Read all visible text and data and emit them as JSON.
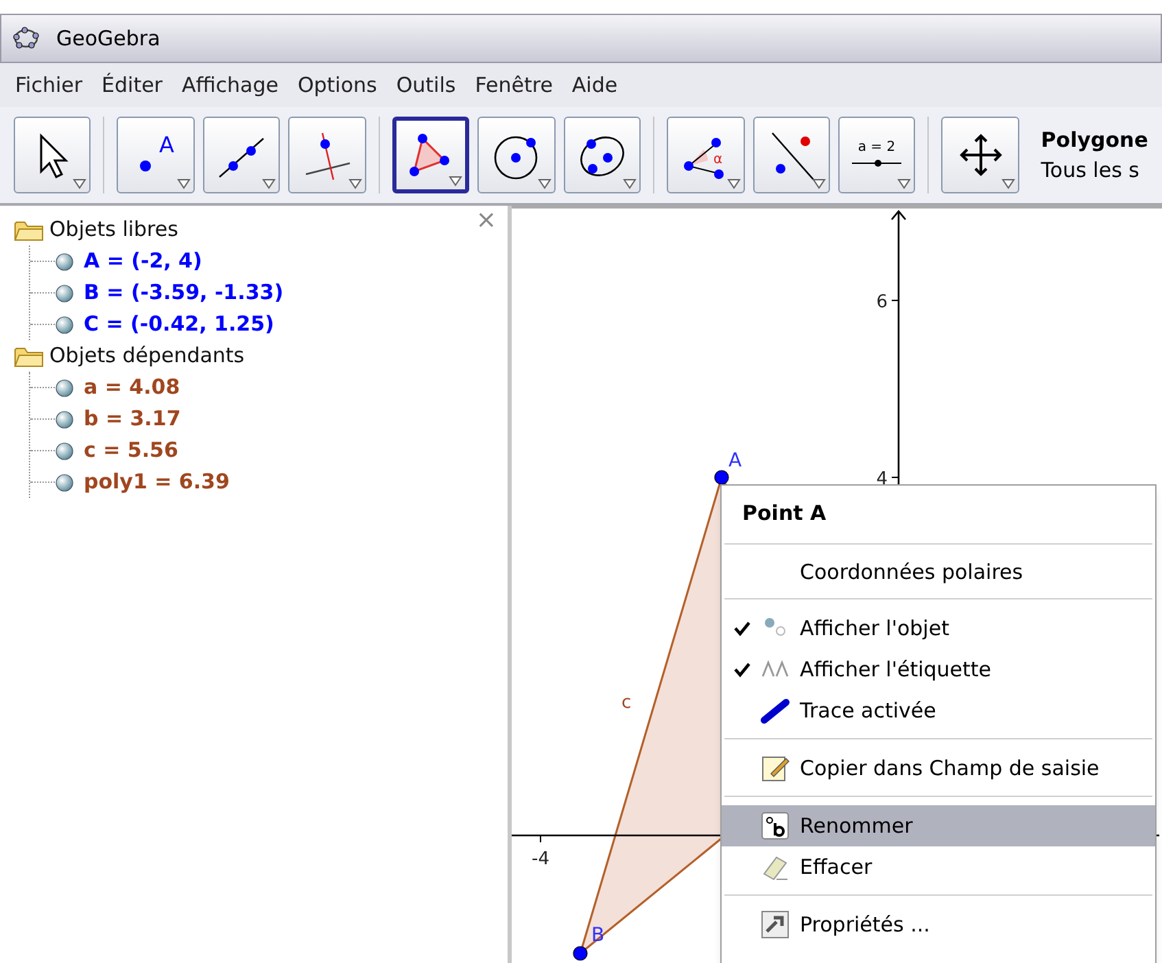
{
  "window": {
    "title": "GeoGebra"
  },
  "menu": [
    "Fichier",
    "Éditer",
    "Affichage",
    "Options",
    "Outils",
    "Fenêtre",
    "Aide"
  ],
  "toolbar": {
    "groups": [
      [
        {
          "kind": "pointer",
          "selected": false
        }
      ],
      [
        {
          "kind": "point",
          "label": "A",
          "selected": false
        },
        {
          "kind": "line",
          "selected": false
        },
        {
          "kind": "perpendicular",
          "selected": false
        }
      ],
      [
        {
          "kind": "polygon",
          "selected": true
        },
        {
          "kind": "circle",
          "selected": false
        },
        {
          "kind": "conic",
          "selected": false
        }
      ],
      [
        {
          "kind": "angle",
          "label": "α",
          "selected": false
        },
        {
          "kind": "reflect",
          "selected": false
        },
        {
          "kind": "slider",
          "label": "a = 2",
          "selected": false
        }
      ],
      [
        {
          "kind": "move",
          "selected": false
        }
      ]
    ],
    "tool_name": "Polygone",
    "tool_help": "Tous les s"
  },
  "algebra": {
    "close": "×",
    "folders": [
      {
        "label": "Objets libres",
        "items": [
          {
            "text": "A = (-2, 4)",
            "color": "#0000ff"
          },
          {
            "text": "B = (-3.59, -1.33)",
            "color": "#0000ff"
          },
          {
            "text": "C = (-0.42, 1.25)",
            "color": "#0000ff"
          }
        ]
      },
      {
        "label": "Objets dépendants",
        "items": [
          {
            "text": "a = 4.08",
            "color": "#a0461e"
          },
          {
            "text": "b = 3.17",
            "color": "#a0461e"
          },
          {
            "text": "c = 5.56",
            "color": "#a0461e"
          },
          {
            "text": "poly1 = 6.39",
            "color": "#a0461e"
          }
        ]
      }
    ]
  },
  "graphics": {
    "y_ticks": [
      "6",
      "4"
    ],
    "x_ticks": [
      "-4"
    ],
    "points": [
      "A",
      "B"
    ],
    "segment_label": "c"
  },
  "context_menu": {
    "title": "Point A",
    "sections": [
      [
        {
          "label": "Coordonnées polaires",
          "kind": "plain",
          "selected": false
        }
      ],
      [
        {
          "label": "Afficher l'objet",
          "kind": "show-object",
          "checked": true,
          "selected": false
        },
        {
          "label": "Afficher l'étiquette",
          "kind": "show-label",
          "checked": true,
          "selected": false
        },
        {
          "label": "Trace activée",
          "kind": "trace",
          "checked": false,
          "selected": false
        }
      ],
      [
        {
          "label": "Copier dans Champ de saisie",
          "kind": "copy",
          "selected": false
        }
      ],
      [
        {
          "label": "Renommer",
          "kind": "rename",
          "selected": true
        },
        {
          "label": "Effacer",
          "kind": "erase",
          "selected": false
        }
      ],
      [
        {
          "label": "Propriétés ...",
          "kind": "properties",
          "selected": false
        }
      ]
    ]
  }
}
